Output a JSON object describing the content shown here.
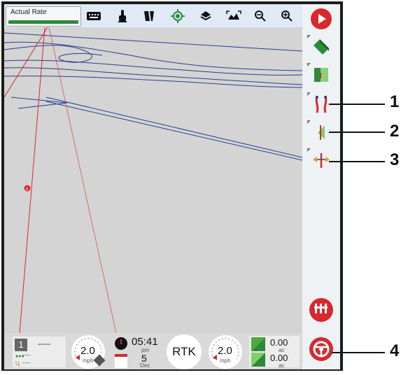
{
  "topbar": {
    "actual_rate_label": "Actual Rate",
    "tools": [
      "keyboard-icon",
      "touch-icon",
      "rows-icon",
      "gps-target-icon",
      "layers-icon",
      "extents-icon",
      "zoom-out-icon",
      "zoom-in-icon"
    ]
  },
  "sidebar": {
    "items": [
      "play-icon",
      "field-boundary-icon",
      "field-marker-icon",
      "guidance-lines-icon",
      "guidance-pattern-icon",
      "adjust-line-icon",
      "autosteer-row-icon",
      "steering-wheel-icon"
    ]
  },
  "bottombar": {
    "section_number": "1",
    "section_value": "-----",
    "row1_value": "-----",
    "row2_value": "-----",
    "speed_left": "2.0",
    "speed_left_unit": "mph",
    "clock_time": "05:41",
    "clock_ampm": "pm",
    "date_day": "5",
    "date_month": "Dec",
    "rtk_label": "RTK",
    "speed_right": "2.0",
    "speed_right_unit": "mph",
    "area1_value": "0.00",
    "area1_unit": "ac",
    "area2_value": "0.00",
    "area2_unit": "ac"
  },
  "callouts": [
    "1",
    "2",
    "3",
    "4"
  ],
  "colors": {
    "accent_red": "#d8282c",
    "green": "#2c8a3a",
    "topbar": "#dfeaf6"
  }
}
